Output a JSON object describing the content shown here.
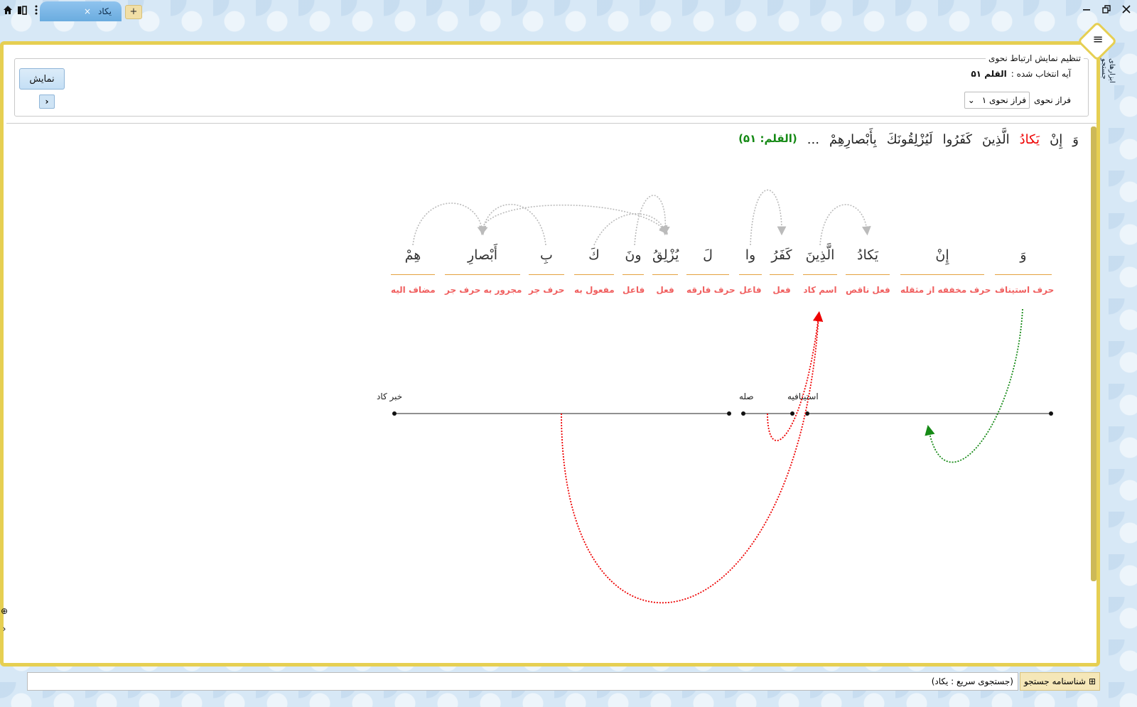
{
  "titlebar": {
    "tab_title": "یکاد",
    "tab_close": "×",
    "tab_add": "+",
    "icons": [
      "home-icon",
      "book-icon",
      "more-vertical-icon"
    ],
    "controls": [
      "minimize-icon",
      "restore-icon",
      "close-icon"
    ]
  },
  "side_tab": "ابزارهای جستجو",
  "settings": {
    "legend": "تنظیم نمایش ارتباط نحوی",
    "selected_label": "آیه انتخاب شده :",
    "selected_value": "القلم ۵۱",
    "faraz_label": "فراز نحوی",
    "faraz_value": "فراز نحوی ۱",
    "show_button": "نمایش",
    "nav_button": "›"
  },
  "ayah": {
    "words": [
      "وَ",
      "إِنْ",
      "یَکادُ",
      "الَّذِینَ",
      "کَفَرُوا",
      "لَیُزْلِقُونَكَ",
      "بِأَبْصارِهِمْ",
      "..."
    ],
    "highlight_index": 2,
    "reference": "(القلم: ۵۱)"
  },
  "words": [
    {
      "text": "وَ",
      "role": "حرف استیناف"
    },
    {
      "text": "إِنْ",
      "role": "حرف مخففه از مثقله"
    },
    {
      "text": "یَکادُ",
      "role": "فعل ناقص"
    },
    {
      "text": "الَّذِینَ",
      "role": "اسم کاد"
    },
    {
      "text": "کَفَرُ",
      "role": "فعل"
    },
    {
      "text": "وا",
      "role": "فاعل"
    },
    {
      "text": "لَ",
      "role": "حرف فارقه"
    },
    {
      "text": "یُزْلِقُ",
      "role": "فعل"
    },
    {
      "text": "ونَ",
      "role": "فاعل"
    },
    {
      "text": "كَ",
      "role": "مفعول به"
    },
    {
      "text": "بِ",
      "role": "حرف جر"
    },
    {
      "text": "أَبْصارِ",
      "role": "مجرور به حرف جر"
    },
    {
      "text": "هِمْ",
      "role": "مضاف الیه"
    }
  ],
  "tree": {
    "labels": [
      "استینافیه",
      "صله",
      "خبر کاد"
    ]
  },
  "bottom": {
    "search_text": "(جستجوی سریع : یکاد)",
    "search_id_label": "شناسنامه جستجو"
  }
}
